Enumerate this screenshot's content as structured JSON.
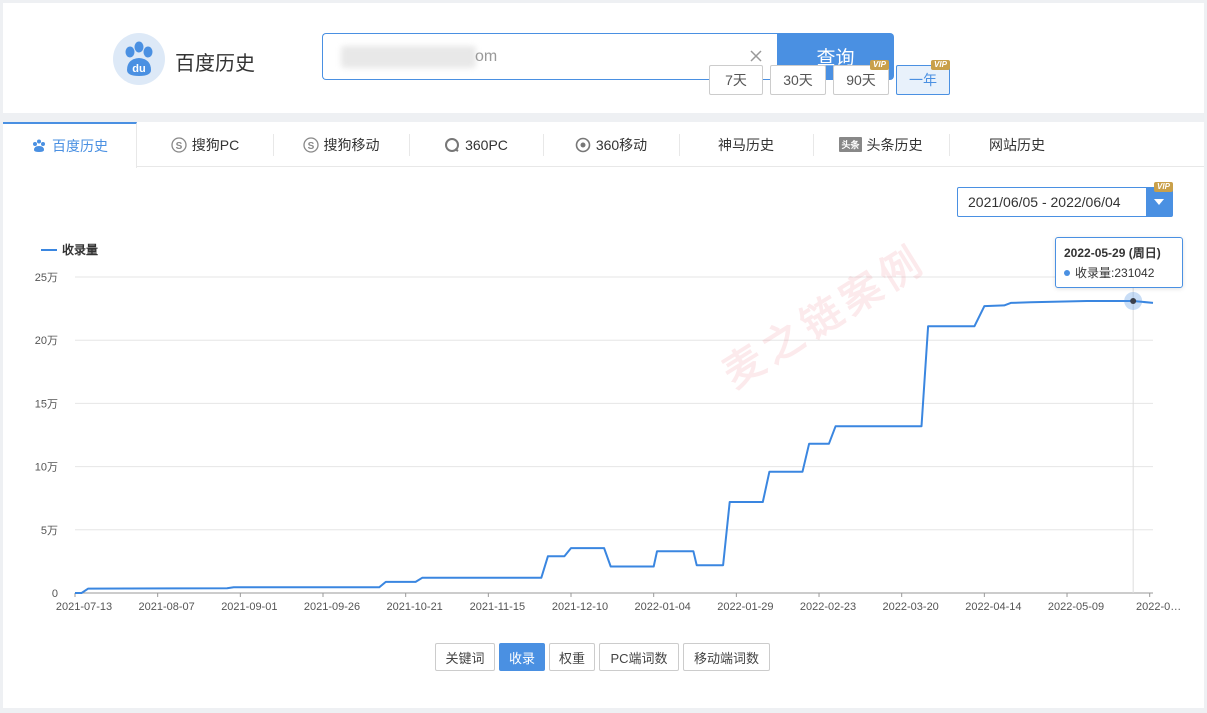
{
  "header": {
    "logo_text": "百度历史",
    "logo_badge": "du",
    "search_value": "om",
    "search_button": "查询"
  },
  "tabs": [
    {
      "label": "百度历史",
      "icon": "baidu-paw-icon",
      "active": true
    },
    {
      "label": "搜狗PC",
      "icon": "sogou-icon",
      "active": false
    },
    {
      "label": "搜狗移动",
      "icon": "sogou-icon",
      "active": false
    },
    {
      "label": "360PC",
      "icon": "360-icon",
      "active": false
    },
    {
      "label": "360移动",
      "icon": "360-mobile-icon",
      "active": false
    },
    {
      "label": "神马历史",
      "icon": "",
      "active": false
    },
    {
      "label": "头条历史",
      "icon": "toutiao-icon",
      "badge": "头条",
      "active": false
    },
    {
      "label": "网站历史",
      "icon": "",
      "active": false
    }
  ],
  "ranges": [
    {
      "label": "7天",
      "vip": false,
      "active": false
    },
    {
      "label": "30天",
      "vip": false,
      "active": false
    },
    {
      "label": "90天",
      "vip": true,
      "active": false
    },
    {
      "label": "一年",
      "vip": true,
      "active": true
    }
  ],
  "vip_label": "VIP",
  "date_range": {
    "value": "2021/06/05 - 2022/06/04",
    "vip": true
  },
  "metrics": [
    {
      "label": "关键词",
      "active": false
    },
    {
      "label": "收录",
      "active": true
    },
    {
      "label": "权重",
      "active": false
    },
    {
      "label": "PC端词数",
      "active": false
    },
    {
      "label": "移动端词数",
      "active": false
    }
  ],
  "watermark": "麦之链案例",
  "tooltip": {
    "date": "2022-05-29 (周日)",
    "label": "收录量",
    "value": "231042"
  },
  "colors": {
    "accent": "#4a90e2",
    "line": "#3a86e0",
    "grid": "#e6e6e6"
  },
  "chart_data": {
    "type": "line",
    "legend": "收录量",
    "legend_position": "top-left",
    "grid": true,
    "ylim": [
      0,
      250000
    ],
    "y_ticks": [
      {
        "value": 0,
        "label": "0"
      },
      {
        "value": 50000,
        "label": "5万"
      },
      {
        "value": 100000,
        "label": "10万"
      },
      {
        "value": 150000,
        "label": "15万"
      },
      {
        "value": 200000,
        "label": "20万"
      },
      {
        "value": 250000,
        "label": "25万"
      }
    ],
    "x_range": [
      "2021-07-13",
      "2022-06-04"
    ],
    "x_ticks": [
      "2021-07-13",
      "2021-08-07",
      "2021-09-01",
      "2021-09-26",
      "2021-10-21",
      "2021-11-15",
      "2021-12-10",
      "2022-01-04",
      "2022-01-29",
      "2022-02-23",
      "2022-03-20",
      "2022-04-14",
      "2022-05-09",
      "2022-0…"
    ],
    "series": [
      {
        "name": "收录量",
        "points": [
          [
            "2021-07-13",
            0
          ],
          [
            "2021-07-15",
            0
          ],
          [
            "2021-07-17",
            3500
          ],
          [
            "2021-08-28",
            3700
          ],
          [
            "2021-08-30",
            4500
          ],
          [
            "2021-10-13",
            4500
          ],
          [
            "2021-10-15",
            8800
          ],
          [
            "2021-10-24",
            8800
          ],
          [
            "2021-10-26",
            12000
          ],
          [
            "2021-12-01",
            12000
          ],
          [
            "2021-12-03",
            29000
          ],
          [
            "2021-12-08",
            29000
          ],
          [
            "2021-12-10",
            35500
          ],
          [
            "2021-12-20",
            35500
          ],
          [
            "2021-12-22",
            21000
          ],
          [
            "2022-01-04",
            21000
          ],
          [
            "2022-01-05",
            33000
          ],
          [
            "2022-01-16",
            33000
          ],
          [
            "2022-01-17",
            22000
          ],
          [
            "2022-01-25",
            22000
          ],
          [
            "2022-01-27",
            72000
          ],
          [
            "2022-02-06",
            72000
          ],
          [
            "2022-02-08",
            96000
          ],
          [
            "2022-02-18",
            96000
          ],
          [
            "2022-02-20",
            118000
          ],
          [
            "2022-02-26",
            118000
          ],
          [
            "2022-02-28",
            132000
          ],
          [
            "2022-03-26",
            132000
          ],
          [
            "2022-03-28",
            211000
          ],
          [
            "2022-04-11",
            211000
          ],
          [
            "2022-04-14",
            227000
          ],
          [
            "2022-04-20",
            227500
          ],
          [
            "2022-04-22",
            229500
          ],
          [
            "2022-04-28",
            230000
          ],
          [
            "2022-05-15",
            231000
          ],
          [
            "2022-05-29",
            231042
          ],
          [
            "2022-06-04",
            229500
          ]
        ]
      }
    ]
  }
}
